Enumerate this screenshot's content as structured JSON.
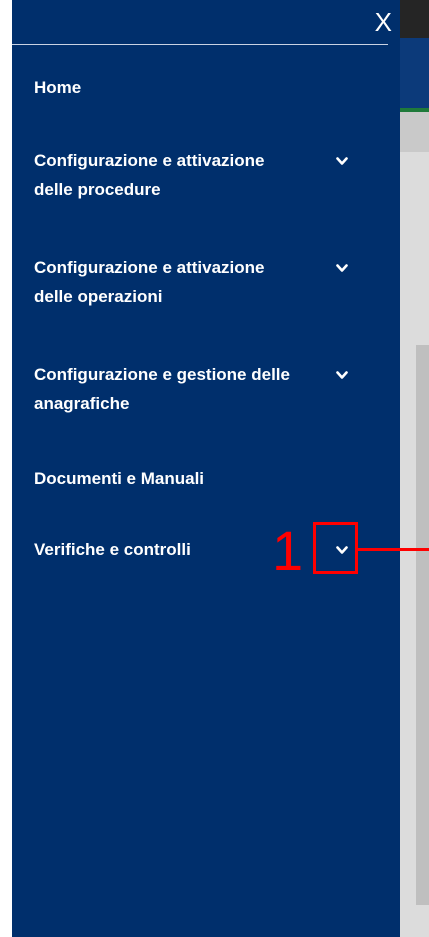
{
  "close_label": "X",
  "menu": {
    "items": [
      {
        "label": "Home"
      },
      {
        "label": "Configurazione e attivazione delle procedure"
      },
      {
        "label": "Configurazione e attivazione delle operazioni"
      },
      {
        "label": "Configurazione e gestione delle anagrafiche"
      },
      {
        "label": "Documenti e Manuali"
      },
      {
        "label": "Verifiche e controlli"
      }
    ]
  },
  "annotation": {
    "number": "1"
  },
  "colors": {
    "sidebar": "#002f6c",
    "text": "#ffffff",
    "annotation": "#ff0000"
  },
  "icons": {
    "expand": "chevron-down-icon",
    "close": "close-icon"
  }
}
